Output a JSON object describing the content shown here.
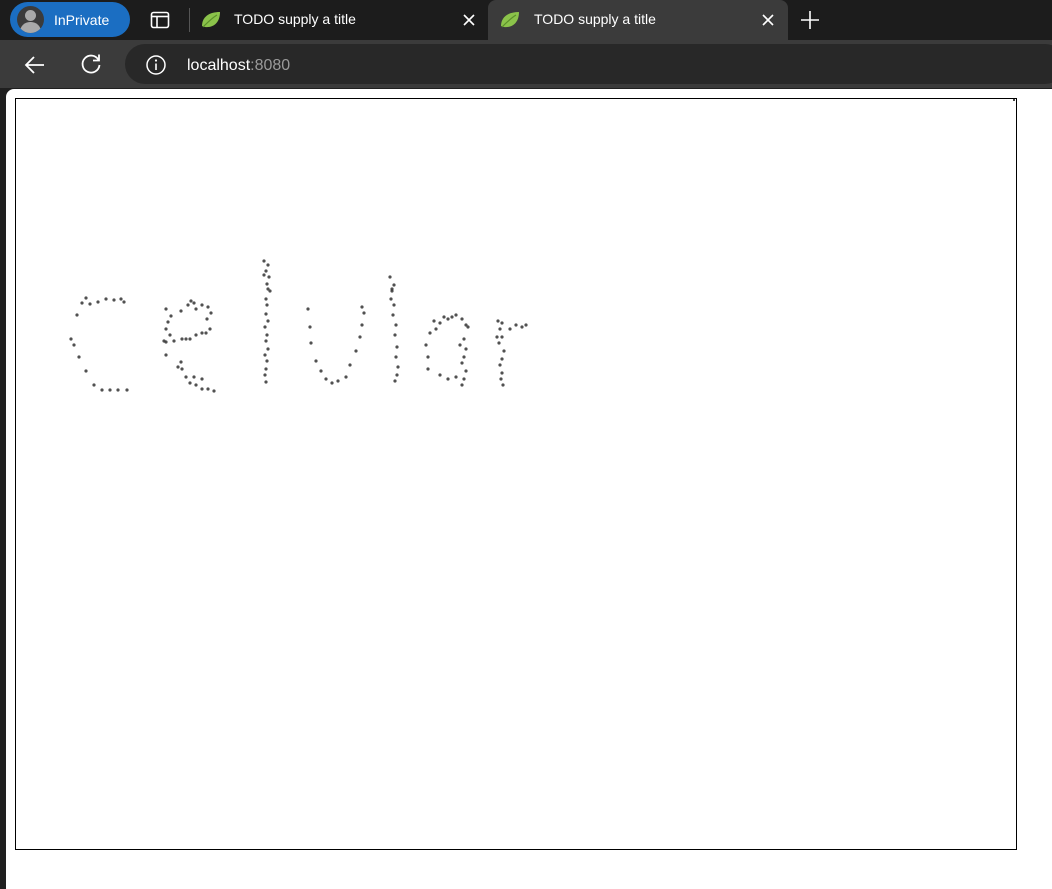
{
  "browser": {
    "inprivate_label": "InPrivate",
    "tabs": [
      {
        "title": "TODO supply a title",
        "active": false,
        "favicon": "leaf-icon"
      },
      {
        "title": "TODO supply a title",
        "active": true,
        "favicon": "leaf-icon"
      }
    ],
    "address": {
      "host": "localhost",
      "port": ":8080"
    }
  },
  "page": {
    "handwritten_word": "celular",
    "dot_color": "#333333",
    "canvas_border_color": "#000000"
  }
}
